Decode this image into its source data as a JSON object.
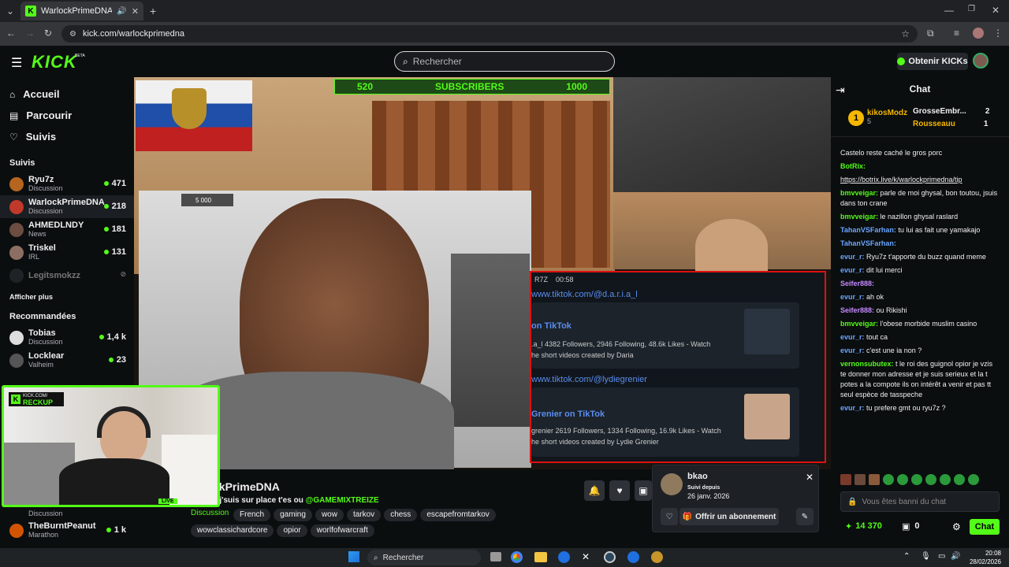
{
  "browser": {
    "tab_title": "WarlockPrimeDNA Stream",
    "url": "kick.com/warlockprimedna"
  },
  "header": {
    "logo": "KICK",
    "beta": "BETA",
    "search_placeholder": "Rechercher",
    "kicks_button": "Obtenir KICKs"
  },
  "sidebar": {
    "nav": [
      {
        "label": "Accueil",
        "icon": "home-icon"
      },
      {
        "label": "Parcourir",
        "icon": "browse-icon"
      },
      {
        "label": "Suivis",
        "icon": "heart-icon"
      }
    ],
    "followed_title": "Suivis",
    "followed": [
      {
        "name": "Ryu7z",
        "category": "Discussion",
        "viewers": "471",
        "color": "#b5651d"
      },
      {
        "name": "WarlockPrimeDNA",
        "category": "Discussion",
        "viewers": "218",
        "color": "#c0392b"
      },
      {
        "name": "AHMEDLNDY",
        "category": "News",
        "viewers": "181",
        "color": "#6d4c41"
      },
      {
        "name": "Triskel",
        "category": "IRL",
        "viewers": "131",
        "color": "#8d6e63"
      },
      {
        "name": "Legitsmokzz",
        "category": "",
        "viewers": "",
        "color": "#3a3d42"
      }
    ],
    "show_more": "Afficher plus",
    "recommended_title": "Recommandées",
    "recommended": [
      {
        "name": "Tobias",
        "category": "Discussion",
        "viewers": "1,4 k",
        "color": "#ddd"
      },
      {
        "name": "Locklear",
        "category": "Valheim",
        "viewers": "23",
        "color": "#555"
      },
      {
        "name": "",
        "category": "Discussion",
        "viewers": "",
        "color": "#333"
      },
      {
        "name": "TheBurntPeanut",
        "category": "Marathon",
        "viewers": "1 k",
        "color": "#d35400"
      }
    ]
  },
  "stream": {
    "overlay_subs": "520",
    "overlay_label": "SUBSCRIBERS",
    "overlay_goal": "1000",
    "cam_timer": "5 000",
    "tiktok_time": "00:58",
    "tiktok_user": "R7Z",
    "tiktok_url1": "www.tiktok.com/@d.a.r.i.a_l",
    "tiktok_title1": "on TikTok",
    "tiktok_desc1": ".a_l 4382 Followers, 2946 Following, 48.6k Likes - Watch",
    "tiktok_desc1b": "he short videos created by Daria",
    "tiktok_url2": "www.tiktok.com/@lydiegrenier",
    "tiktok_title2": "Grenier on TikTok",
    "tiktok_desc2": "grenier 2619 Followers, 1334 Following, 16.9k Likes - Watch",
    "tiktok_desc2b": "he short videos created by Lydie Grenier"
  },
  "cam_badge": {
    "top": "KICK.COM/",
    "bottom": "RECKUP",
    "live": "LIVE"
  },
  "streamer": {
    "name": "ckPrimeDNA",
    "title": "s j'suis sur place t'es ou",
    "mention": "@GAMEMIXTREIZE",
    "category": "Discussion",
    "tags": [
      "French",
      "gaming",
      "wow",
      "tarkov",
      "chess",
      "escapefromtarkov",
      "wowclassichardcore",
      "opior",
      "worlfofwarcraft"
    ]
  },
  "notification": {
    "user": "bkao",
    "followed_label": "Suivi depuis",
    "followed_date": "26 janv. 2026",
    "sub_button": "Offrir un abonnement"
  },
  "chat": {
    "title": "Chat",
    "leaderboard": [
      {
        "name": "kikosModz",
        "value": "5"
      },
      {
        "name": "GrosseEmbr...",
        "value": "2"
      },
      {
        "name": "Rousseauu",
        "value": "1"
      }
    ],
    "messages": [
      {
        "user": "",
        "text": "Castelo reste caché le gros porc",
        "color": "#efeff1"
      },
      {
        "user": "BotRix:",
        "text": "",
        "color": "#53fc18"
      },
      {
        "user": "",
        "text": "https://botrix.live/k/warlockprimedna/tip",
        "color": "#efeff1"
      },
      {
        "user": "bmvveigar:",
        "text": "parle de moi ghysal, bon toutou, jsuis dans ton crane",
        "color": "#53fc18"
      },
      {
        "user": "bmvveigar:",
        "text": "le nazillon ghysal raslard",
        "color": "#53fc18"
      },
      {
        "user": "TahanVSFarhan:",
        "text": "tu lui as fait une yamakajo",
        "color": "#6aa6ff"
      },
      {
        "user": "TahanVSFarhan:",
        "text": "",
        "color": "#6aa6ff"
      },
      {
        "user": "evur_r:",
        "text": "Ryu7z t'apporte du buzz quand meme",
        "color": "#6aa6ff"
      },
      {
        "user": "evur_r:",
        "text": "dit lui merci",
        "color": "#6aa6ff"
      },
      {
        "user": "Seifer888:",
        "text": "",
        "color": "#c58aff"
      },
      {
        "user": "evur_r:",
        "text": "ah ok",
        "color": "#6aa6ff"
      },
      {
        "user": "Seifer888:",
        "text": "ou Rikishi",
        "color": "#c58aff"
      },
      {
        "user": "bmvveigar:",
        "text": "l'obese morbide muslim casino",
        "color": "#53fc18"
      },
      {
        "user": "evur_r:",
        "text": "tout ca",
        "color": "#6aa6ff"
      },
      {
        "user": "evur_r:",
        "text": "c'est une ia non ?",
        "color": "#6aa6ff"
      },
      {
        "user": "vernonsubutex:",
        "text": "t le roi des guignol opior je vzis te donner mon adresse et je suis serieux et la t potes a la compote ils on intérêt a venir et pas tt seul espèce de tasspeche",
        "color": "#53fc18"
      },
      {
        "user": "evur_r:",
        "text": "tu prefere gmt ou ryu7z ?",
        "color": "#6aa6ff"
      }
    ],
    "banned_placeholder": "Vous êtes banni du chat",
    "points": "14 370",
    "gifts": "0",
    "send_button": "Chat"
  },
  "taskbar": {
    "search": "Rechercher",
    "time": "20:08",
    "date": "28/02/2026"
  }
}
